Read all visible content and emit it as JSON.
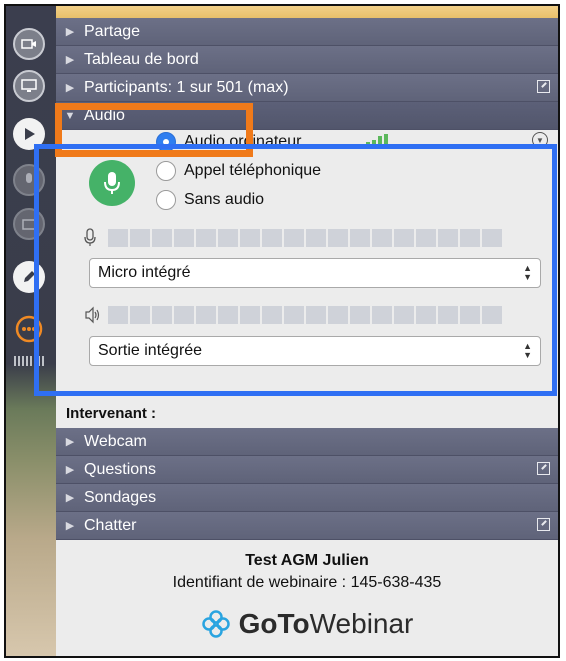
{
  "sections_top": [
    {
      "label": "Partage",
      "expanded": false,
      "popout": false
    },
    {
      "label": "Tableau de bord",
      "expanded": false,
      "popout": false
    },
    {
      "label": "Participants: 1 sur 501 (max)",
      "expanded": false,
      "popout": true
    }
  ],
  "audio": {
    "section_label": "Audio",
    "mic_icon": "microphone-icon",
    "options": [
      {
        "label": "Audio ordinateur",
        "selected": true
      },
      {
        "label": "Appel téléphonique",
        "selected": false
      },
      {
        "label": "Sans audio",
        "selected": false
      }
    ],
    "microphone_select": "Micro intégré",
    "speaker_select": "Sortie intégrée",
    "signal_level": 0.6,
    "mic_meter_level": 0,
    "speaker_meter_level": 0,
    "accent_green": "#45b268",
    "radio_blue": "#2f7ef0"
  },
  "intervenant_label": "Intervenant :",
  "sections_bottom": [
    {
      "label": "Webcam",
      "expanded": false,
      "popout": false
    },
    {
      "label": "Questions",
      "expanded": false,
      "popout": true
    },
    {
      "label": "Sondages",
      "expanded": false,
      "popout": false
    },
    {
      "label": "Chatter",
      "expanded": false,
      "popout": true
    }
  ],
  "footer": {
    "webinar_title": "Test AGM Julien",
    "webinar_id": "Identifiant de webinaire : 145-638-435",
    "logo_goto": "GoTo",
    "logo_webinar": "Webinar"
  },
  "toolbar_icons": [
    "webcam-icon",
    "screen-icon",
    "play-icon",
    "microphone-icon",
    "share-icon",
    "pen-icon",
    "chat-icon"
  ],
  "annotation_colors": {
    "orange": "#f07a1a",
    "blue": "#2f6ff3"
  }
}
